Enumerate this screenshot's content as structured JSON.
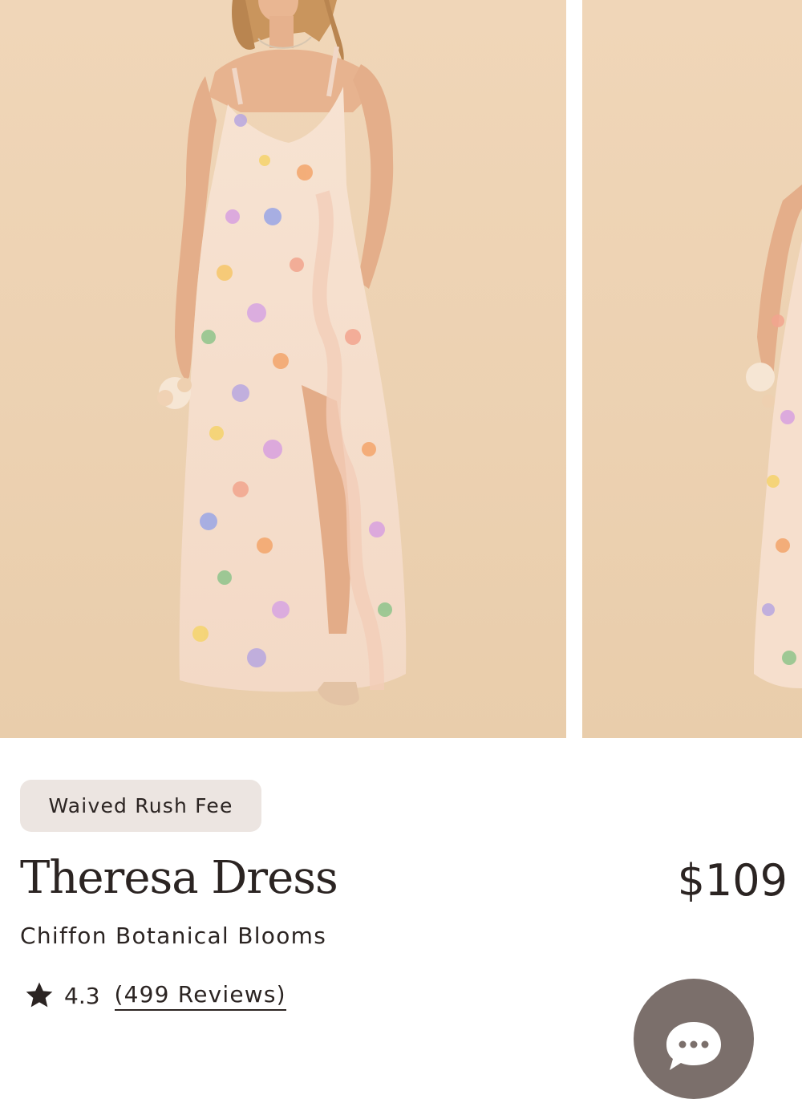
{
  "product": {
    "badge": "Waived Rush Fee",
    "name": "Theresa Dress",
    "price": "$109",
    "variant": "Chiffon Botanical Blooms",
    "rating": "4.3",
    "reviews_link": "(499 Reviews)"
  },
  "gallery": {
    "images": [
      {
        "alt": "Model wearing floral chiffon maxi dress, front view"
      },
      {
        "alt": "Model wearing floral chiffon maxi dress, partial next image"
      }
    ]
  },
  "icons": {
    "rating": "star-icon",
    "chat": "chat-bubble-icon"
  },
  "colors": {
    "text": "#2b2422",
    "badge_bg": "#ece5e1",
    "photo_bg": "#efd5b5",
    "chat_button": "#7b6f6b"
  }
}
